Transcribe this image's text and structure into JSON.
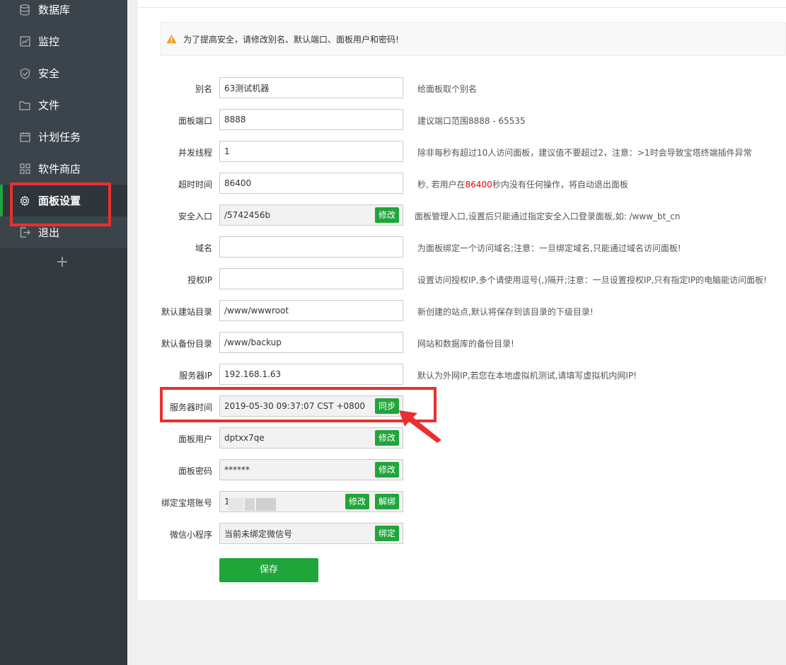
{
  "sidebar": {
    "items": [
      {
        "label": "数据库",
        "icon": "database-icon"
      },
      {
        "label": "监控",
        "icon": "monitor-icon"
      },
      {
        "label": "安全",
        "icon": "shield-icon"
      },
      {
        "label": "文件",
        "icon": "folder-icon"
      },
      {
        "label": "计划任务",
        "icon": "calendar-icon"
      },
      {
        "label": "软件商店",
        "icon": "grid-icon"
      },
      {
        "label": "面板设置",
        "icon": "gear-icon",
        "active": true
      },
      {
        "label": "退出",
        "icon": "logout-icon"
      }
    ],
    "add_label": "+"
  },
  "warning": {
    "text": "为了提高安全，请修改别名、默认端口、面板用户和密码!",
    "icon": "warning-icon"
  },
  "form": {
    "alias": {
      "label": "别名",
      "value": "63测试机器",
      "hint": "给面板取个别名"
    },
    "port": {
      "label": "面板端口",
      "value": "8888",
      "hint": "建议端口范围8888 - 65535"
    },
    "threads": {
      "label": "并发线程",
      "value": "1",
      "hint": "除非每秒有超过10人访问面板，建议值不要超过2，注意：>1时会导致宝塔终端插件异常"
    },
    "timeout": {
      "label": "超时时间",
      "value": "86400",
      "hint_pre": "秒, 若用户在",
      "hint_red": "86400",
      "hint_post": "秒内没有任何操作，将自动退出面板"
    },
    "entry": {
      "label": "安全入口",
      "value": "/5742456b",
      "button": "修改",
      "hint": "面板管理入口,设置后只能通过指定安全入口登录面板,如: /www_bt_cn"
    },
    "domain": {
      "label": "域名",
      "value": "",
      "hint": "为面板绑定一个访问域名;注意：一旦绑定域名,只能通过域名访问面板!"
    },
    "auth_ip": {
      "label": "授权IP",
      "value": "",
      "hint": "设置访问授权IP,多个请使用逗号(,)隔开;注意：一旦设置授权IP,只有指定IP的电脑能访问面板!"
    },
    "site_dir": {
      "label": "默认建站目录",
      "value": "/www/wwwroot",
      "hint": "新创建的站点,默认将保存到该目录的下级目录!"
    },
    "backup_dir": {
      "label": "默认备份目录",
      "value": "/www/backup",
      "hint": "网站和数据库的备份目录!"
    },
    "server_ip": {
      "label": "服务器IP",
      "value": "192.168.1.63",
      "hint": "默认为外网IP,若您在本地虚拟机测试,请填写虚拟机内网IP!"
    },
    "server_time": {
      "label": "服务器时间",
      "value": "2019-05-30 09:37:07 CST +0800",
      "button": "同步"
    },
    "panel_user": {
      "label": "面板用户",
      "value": "dptxx7qe",
      "button": "修改"
    },
    "panel_pass": {
      "label": "面板密码",
      "value": "******",
      "button": "修改"
    },
    "bt_account": {
      "label": "绑定宝塔账号",
      "value": "1",
      "button_edit": "修改",
      "button_unbind": "解绑"
    },
    "wechat": {
      "label": "微信小程序",
      "value": "当前未绑定微信号",
      "button": "绑定"
    }
  },
  "save_label": "保存"
}
